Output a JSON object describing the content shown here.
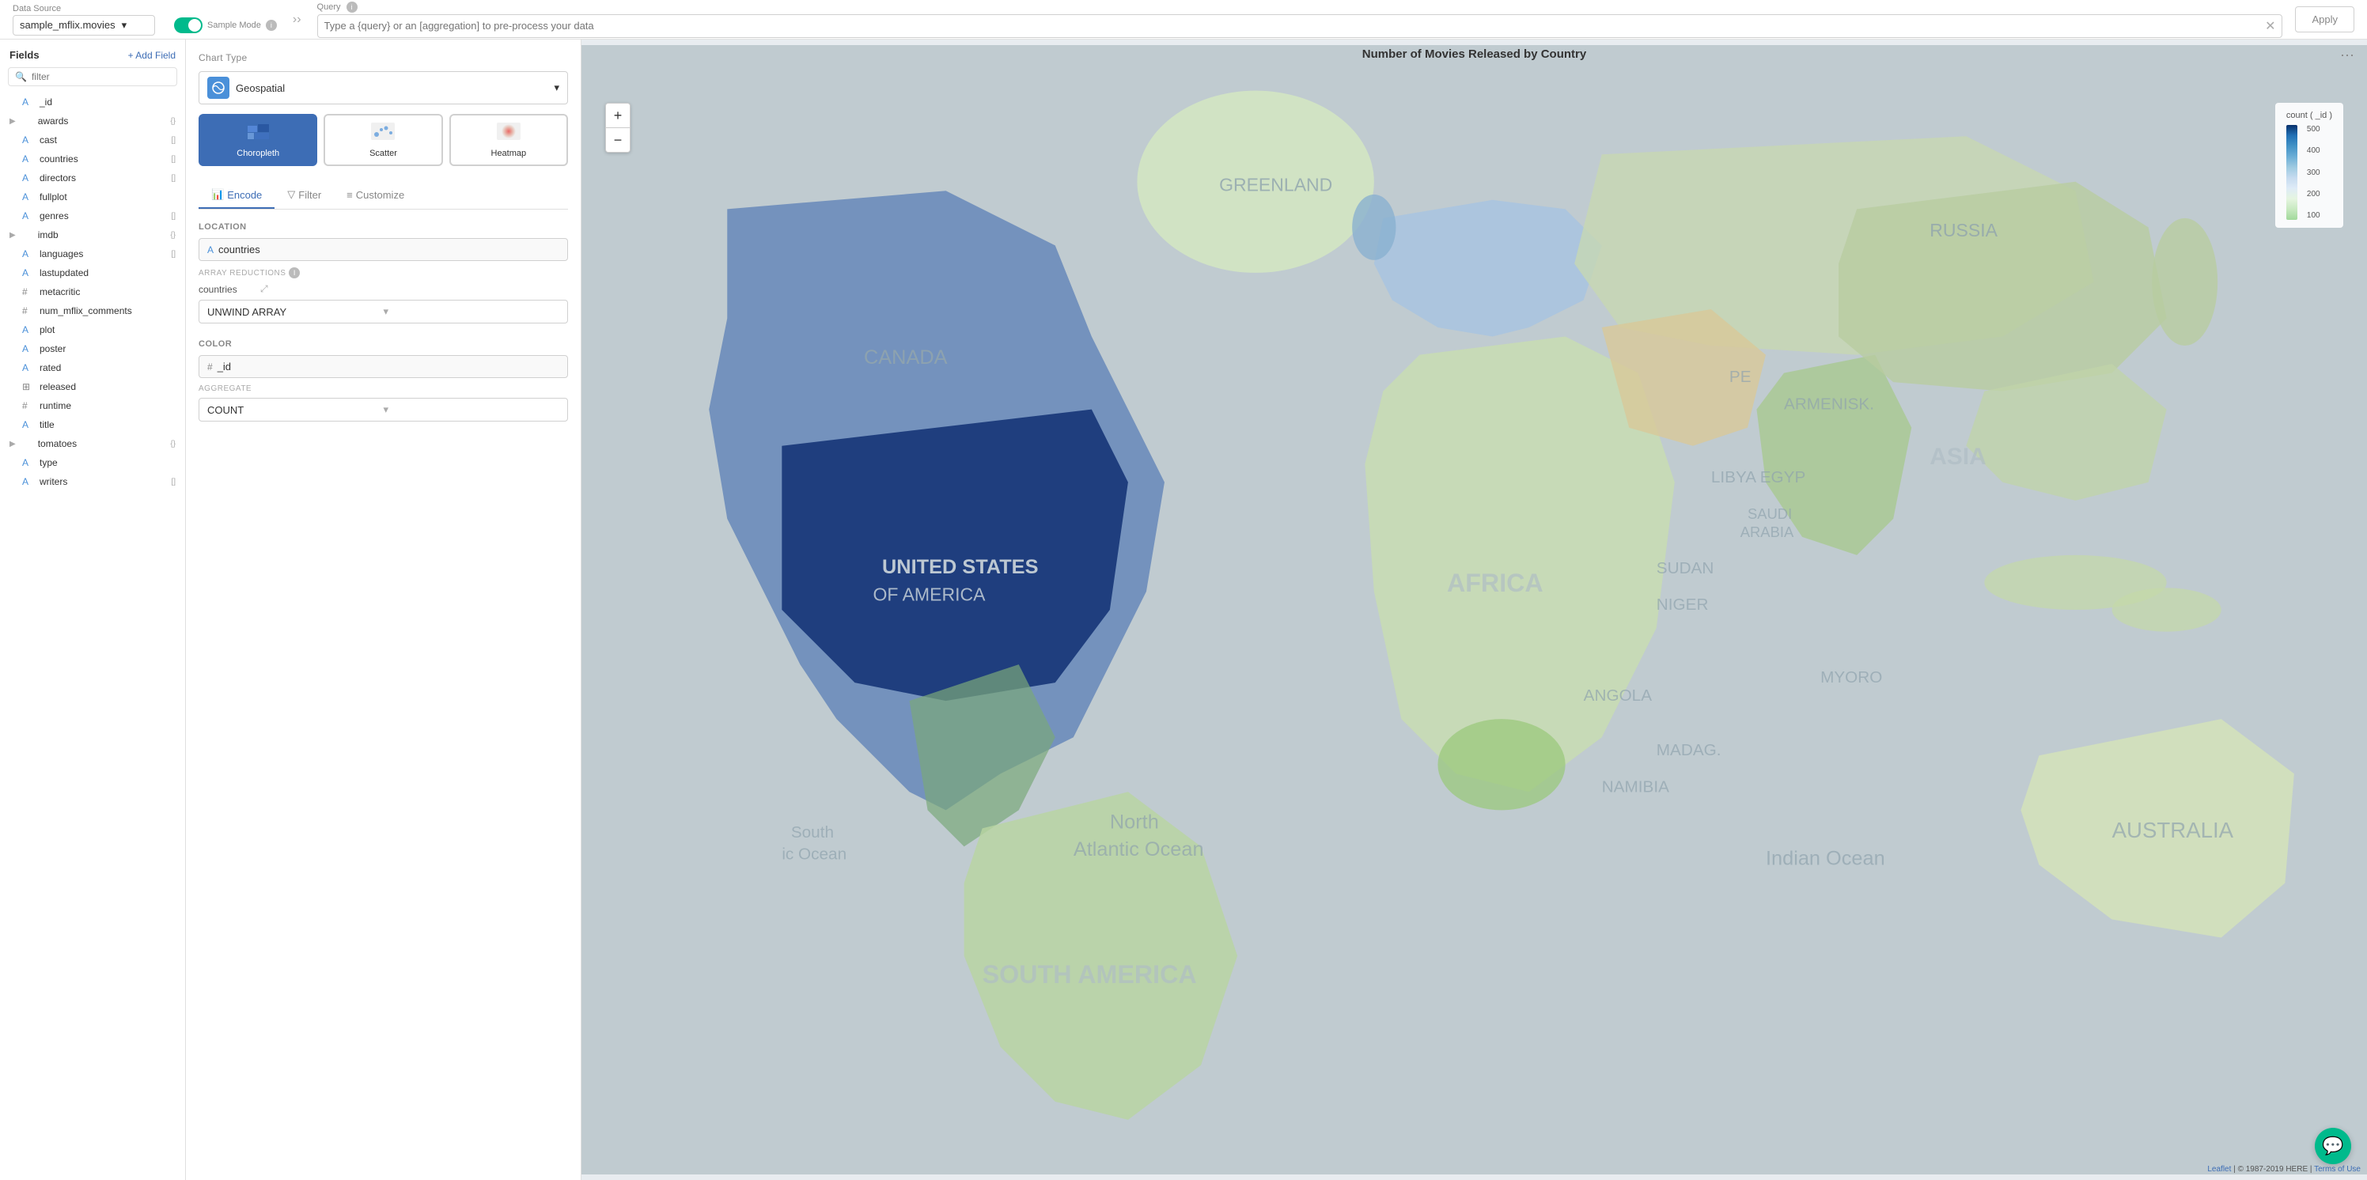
{
  "header": {
    "data_source_label": "Data Source",
    "sample_mode_label": "Sample Mode",
    "query_label": "Query",
    "datasource_value": "sample_mflix.movies",
    "query_placeholder": "Type a {query} or an [aggregation] to pre-process your data",
    "apply_label": "Apply",
    "info_icon": "i"
  },
  "fields": {
    "title": "Fields",
    "add_field_label": "+ Add Field",
    "filter_placeholder": "filter",
    "items": [
      {
        "name": "_id",
        "type": "string",
        "icon": "A",
        "badge": ""
      },
      {
        "name": "awards",
        "type": "object",
        "icon": "",
        "badge": "{}",
        "expand": true
      },
      {
        "name": "cast",
        "type": "array",
        "icon": "A",
        "badge": "[]"
      },
      {
        "name": "countries",
        "type": "array",
        "icon": "A",
        "badge": "[]"
      },
      {
        "name": "directors",
        "type": "array",
        "icon": "A",
        "badge": "[]"
      },
      {
        "name": "fullplot",
        "type": "string",
        "icon": "A",
        "badge": ""
      },
      {
        "name": "genres",
        "type": "array",
        "icon": "A",
        "badge": "[]"
      },
      {
        "name": "imdb",
        "type": "object",
        "icon": "",
        "badge": "{}",
        "expand": true
      },
      {
        "name": "languages",
        "type": "array",
        "icon": "A",
        "badge": "[]"
      },
      {
        "name": "lastupdated",
        "type": "string",
        "icon": "A",
        "badge": ""
      },
      {
        "name": "metacritic",
        "type": "number",
        "icon": "#",
        "badge": ""
      },
      {
        "name": "num_mflix_comments",
        "type": "number",
        "icon": "#",
        "badge": ""
      },
      {
        "name": "plot",
        "type": "string",
        "icon": "A",
        "badge": ""
      },
      {
        "name": "poster",
        "type": "string",
        "icon": "A",
        "badge": ""
      },
      {
        "name": "rated",
        "type": "string",
        "icon": "A",
        "badge": ""
      },
      {
        "name": "released",
        "type": "date",
        "icon": "⊞",
        "badge": ""
      },
      {
        "name": "runtime",
        "type": "number",
        "icon": "#",
        "badge": ""
      },
      {
        "name": "title",
        "type": "string",
        "icon": "A",
        "badge": ""
      },
      {
        "name": "tomatoes",
        "type": "object",
        "icon": "",
        "badge": "{}",
        "expand": true
      },
      {
        "name": "type",
        "type": "string",
        "icon": "A",
        "badge": ""
      },
      {
        "name": "writers",
        "type": "array",
        "icon": "A",
        "badge": "[]"
      }
    ]
  },
  "config": {
    "chart_type_label": "Chart Type",
    "chart_type_value": "Geospatial",
    "subtypes": [
      {
        "label": "Choropleth",
        "active": true
      },
      {
        "label": "Scatter",
        "active": false
      },
      {
        "label": "Heatmap",
        "active": false
      }
    ],
    "tabs": [
      {
        "label": "Encode",
        "icon": "📊",
        "active": true
      },
      {
        "label": "Filter",
        "icon": "▽",
        "active": false
      },
      {
        "label": "Customize",
        "icon": "≡",
        "active": false
      }
    ],
    "location": {
      "title": "Location",
      "field_icon": "A",
      "field_name": "countries",
      "array_reductions_label": "ARRAY REDUCTIONS",
      "select_label": "countries",
      "unwind_array_label": "UNWIND ARRAY",
      "resize_icon": "⤢"
    },
    "color": {
      "title": "Color",
      "field_icon": "#",
      "field_name": "_id",
      "aggregate_label": "AGGREGATE",
      "count_label": "COUNT"
    }
  },
  "map": {
    "title": "Number of Movies Released by Country",
    "legend_title": "count ( _id )",
    "legend_values": [
      "500",
      "400",
      "300",
      "200",
      "100"
    ],
    "zoom_in": "+",
    "zoom_out": "−",
    "credit_leaflet": "Leaflet",
    "credit_here": "© 1987-2019 HERE",
    "credit_terms": "Terms of Use"
  },
  "chat": {
    "icon": "💬"
  }
}
